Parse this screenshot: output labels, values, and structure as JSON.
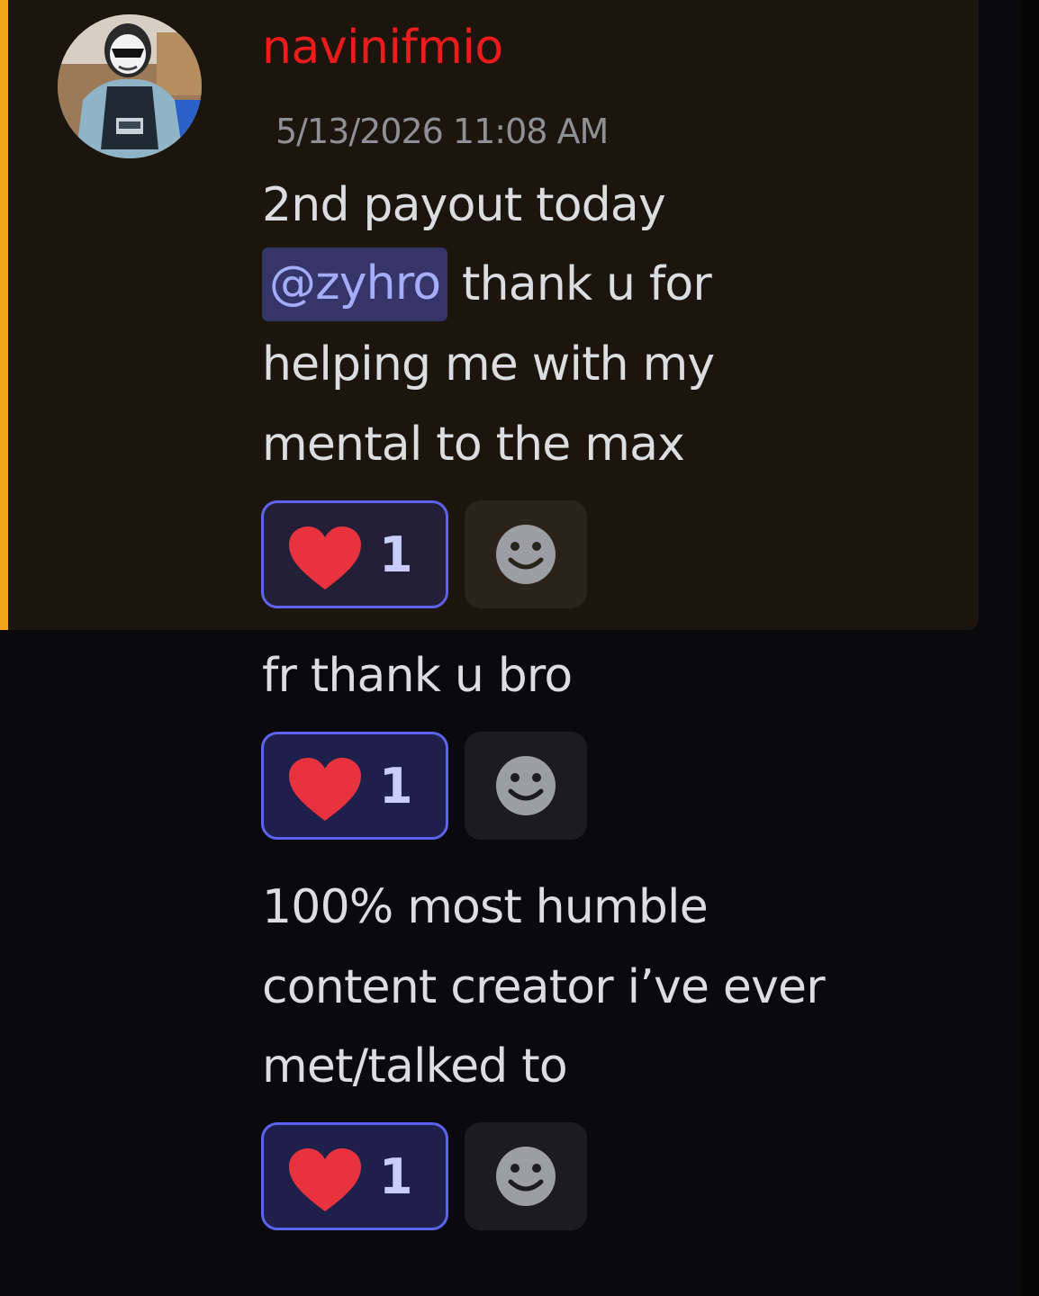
{
  "message_group": {
    "author": {
      "username": "navinifmio",
      "username_color": "#ee1b1b"
    },
    "timestamp": "5/13/2026 11:08 AM",
    "highlight": {
      "mention_bar_color": "#f0a51b",
      "background": "#1b150d"
    },
    "messages": [
      {
        "lines": {
          "l1": "2nd payout today",
          "l2_mention": "@zyhro",
          "l2_rest": " thank u for",
          "l3": "helping me with my",
          "l4": "mental to the max"
        },
        "reaction": {
          "emoji": "heart-icon",
          "count": "1"
        }
      },
      {
        "lines": {
          "l1": "fr thank u bro"
        },
        "reaction": {
          "emoji": "heart-icon",
          "count": "1"
        }
      },
      {
        "lines": {
          "l1": "100% most humble",
          "l2": "content creator i’ve ever",
          "l3": "met/talked to"
        },
        "reaction": {
          "emoji": "heart-icon",
          "count": "1"
        }
      }
    ]
  },
  "colors": {
    "mention_bg": "#35356a",
    "mention_text": "#a5acf9",
    "reaction_border": "#5c63f1",
    "heart": "#e8323e"
  }
}
